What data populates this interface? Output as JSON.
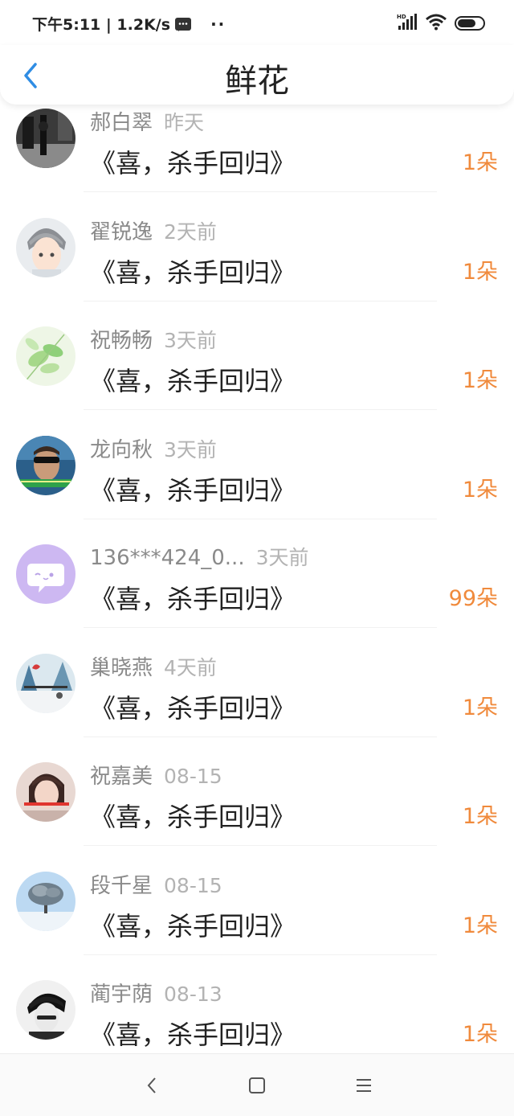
{
  "status_bar": {
    "time_speed": "下午5:11 | 1.2K/s",
    "dots": "··",
    "hd_label": "HD"
  },
  "header": {
    "title": "鲜花"
  },
  "colors": {
    "accent_blue": "#2f8de4",
    "flower_orange": "#f08a3c"
  },
  "items": [
    {
      "name": "郝白翠",
      "time": "昨天",
      "book": "《喜，杀手回归》",
      "count": "1朵",
      "avatar": "photo-street"
    },
    {
      "name": "翟锐逸",
      "time": "2天前",
      "book": "《喜，杀手回归》",
      "count": "1朵",
      "avatar": "anime-boy"
    },
    {
      "name": "祝畅畅",
      "time": "3天前",
      "book": "《喜，杀手回归》",
      "count": "1朵",
      "avatar": "green-leaves"
    },
    {
      "name": "龙向秋",
      "time": "3天前",
      "book": "《喜，杀手回归》",
      "count": "1朵",
      "avatar": "man-sunglasses"
    },
    {
      "name": "136***424_0...",
      "time": "3天前",
      "book": "《喜，杀手回归》",
      "count": "99朵",
      "avatar": "default-chat"
    },
    {
      "name": "巢晓燕",
      "time": "4天前",
      "book": "《喜，杀手回归》",
      "count": "1朵",
      "avatar": "winter-scene"
    },
    {
      "name": "祝嘉美",
      "time": "08-15",
      "book": "《喜，杀手回归》",
      "count": "1朵",
      "avatar": "girl-selfie"
    },
    {
      "name": "段千星",
      "time": "08-15",
      "book": "《喜，杀手回归》",
      "count": "1朵",
      "avatar": "snow-tree"
    },
    {
      "name": "蔺宇荫",
      "time": "08-13",
      "book": "《喜，杀手回归》",
      "count": "1朵",
      "avatar": "bw-boy"
    }
  ],
  "nav": {
    "back": "back-nav-icon",
    "home": "home-nav-icon",
    "menu": "menu-nav-icon"
  }
}
